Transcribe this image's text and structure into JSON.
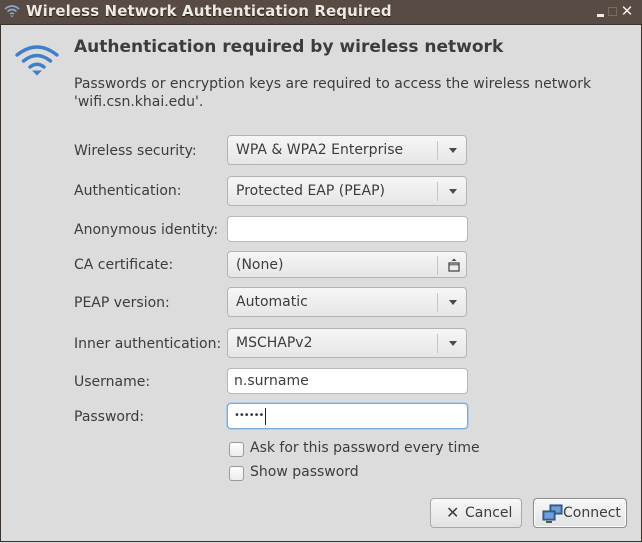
{
  "window": {
    "title": "Wireless Network Authentication Required",
    "icon": "wifi-icon",
    "controls": {
      "minimize": "minimize-icon",
      "maximize": "maximize-icon",
      "close": "close-icon",
      "close_glyph": "✕"
    }
  },
  "dialog": {
    "icon": "wifi-signal-icon",
    "heading": "Authentication required by wireless network",
    "description_line1": "Passwords or encryption keys are required to access the wireless network",
    "description_line2": "'wifi.csn.khai.edu'."
  },
  "form": {
    "wireless_security": {
      "label": "Wireless security:",
      "value": "WPA & WPA2 Enterprise"
    },
    "authentication": {
      "label": "Authentication:",
      "value": "Protected EAP (PEAP)"
    },
    "anonymous_identity": {
      "label": "Anonymous identity:",
      "value": ""
    },
    "ca_certificate": {
      "label": "CA certificate:",
      "value": "(None)",
      "icon": "file-chooser-icon"
    },
    "peap_version": {
      "label": "PEAP version:",
      "value": "Automatic"
    },
    "inner_authentication": {
      "label": "Inner authentication:",
      "value": "MSCHAPv2"
    },
    "username": {
      "label": "Username:",
      "value": "n.surname"
    },
    "password": {
      "label": "Password:",
      "value": "••••••"
    },
    "ask_password": {
      "label": "Ask for this password every time",
      "checked": false
    },
    "show_password": {
      "label": "Show password",
      "checked": false
    }
  },
  "buttons": {
    "cancel": {
      "label": "Cancel",
      "icon": "cancel-x-icon",
      "glyph": "✕"
    },
    "connect": {
      "label": "Connect",
      "icon": "network-icon"
    }
  },
  "colors": {
    "titlebar": "#574b43",
    "background": "#dcdcdc",
    "focus": "#7cacd8",
    "wifi_icon": "#3f7fc9"
  }
}
